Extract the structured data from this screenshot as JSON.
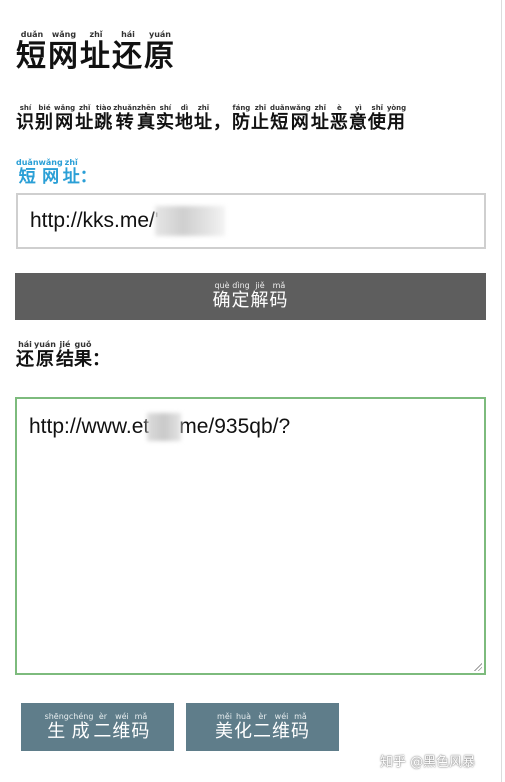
{
  "title": {
    "chars": [
      {
        "c": "短",
        "py": "duǎn"
      },
      {
        "c": "网",
        "py": "wǎng"
      },
      {
        "c": "址",
        "py": "zhǐ"
      },
      {
        "c": "还",
        "py": "hái"
      },
      {
        "c": "原",
        "py": "yuán"
      }
    ]
  },
  "subtitle": {
    "chars": [
      {
        "c": "识",
        "py": "shí"
      },
      {
        "c": "别",
        "py": "bié"
      },
      {
        "c": "网",
        "py": "wǎng"
      },
      {
        "c": "址",
        "py": "zhǐ"
      },
      {
        "c": "跳",
        "py": "tiào"
      },
      {
        "c": "转",
        "py": "zhuǎn"
      },
      {
        "c": "真",
        "py": "zhēn"
      },
      {
        "c": "实",
        "py": "shí"
      },
      {
        "c": "地",
        "py": "dì"
      },
      {
        "c": "址",
        "py": "zhǐ"
      },
      {
        "c": "，",
        "py": ""
      },
      {
        "c": "防",
        "py": "fáng"
      },
      {
        "c": "止",
        "py": "zhǐ"
      },
      {
        "c": "短",
        "py": "duǎn"
      },
      {
        "c": "网",
        "py": "wǎng"
      },
      {
        "c": "址",
        "py": "zhǐ"
      },
      {
        "c": "恶",
        "py": "è"
      },
      {
        "c": "意",
        "py": "yì"
      },
      {
        "c": "使",
        "py": "shǐ"
      },
      {
        "c": "用",
        "py": "yòng"
      }
    ]
  },
  "url_label": {
    "chars": [
      {
        "c": "短",
        "py": "duǎn"
      },
      {
        "c": "网",
        "py": "wǎng"
      },
      {
        "c": "址",
        "py": "zhǐ"
      }
    ],
    "suffix": "："
  },
  "url_input": {
    "value": "http://kks.me/'"
  },
  "confirm_button": {
    "chars": [
      {
        "c": "确",
        "py": "què"
      },
      {
        "c": "定",
        "py": "dìng"
      },
      {
        "c": "解",
        "py": "jiě"
      },
      {
        "c": "码",
        "py": "mǎ"
      }
    ]
  },
  "result_label": {
    "chars": [
      {
        "c": "还",
        "py": "hái"
      },
      {
        "c": "原",
        "py": "yuán"
      },
      {
        "c": "结",
        "py": "jié"
      },
      {
        "c": "果",
        "py": "guǒ"
      }
    ],
    "suffix": "："
  },
  "result": {
    "prefix": "http://www.et",
    "suffix": "me/935qb/?"
  },
  "generate_button": {
    "chars": [
      {
        "c": "生",
        "py": "shēng"
      },
      {
        "c": "成",
        "py": "chéng"
      },
      {
        "c": "二",
        "py": "èr"
      },
      {
        "c": "维",
        "py": "wéi"
      },
      {
        "c": "码",
        "py": "mǎ"
      }
    ]
  },
  "beautify_button": {
    "chars": [
      {
        "c": "美",
        "py": "měi"
      },
      {
        "c": "化",
        "py": "huà"
      },
      {
        "c": "二",
        "py": "èr"
      },
      {
        "c": "维",
        "py": "wéi"
      },
      {
        "c": "码",
        "py": "mǎ"
      }
    ]
  },
  "watermark": "知乎 @黑色风暴"
}
